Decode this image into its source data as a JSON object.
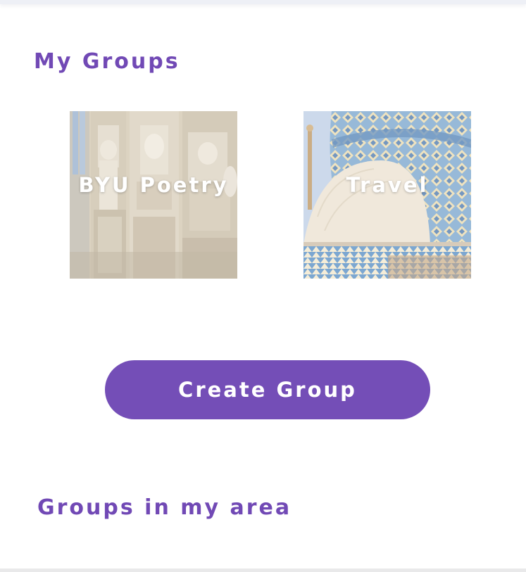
{
  "my_groups": {
    "title": "My Groups",
    "groups": [
      {
        "label": "BYU Poetry",
        "image": "cathedral-statues-photo"
      },
      {
        "label": "Travel",
        "image": "tiled-dome-photo"
      }
    ]
  },
  "create_group": {
    "label": "Create Group"
  },
  "groups_in_area": {
    "title": "Groups in my area"
  },
  "colors": {
    "accent": "#744eb7",
    "heading": "#7149b5",
    "background": "#ffffff"
  }
}
